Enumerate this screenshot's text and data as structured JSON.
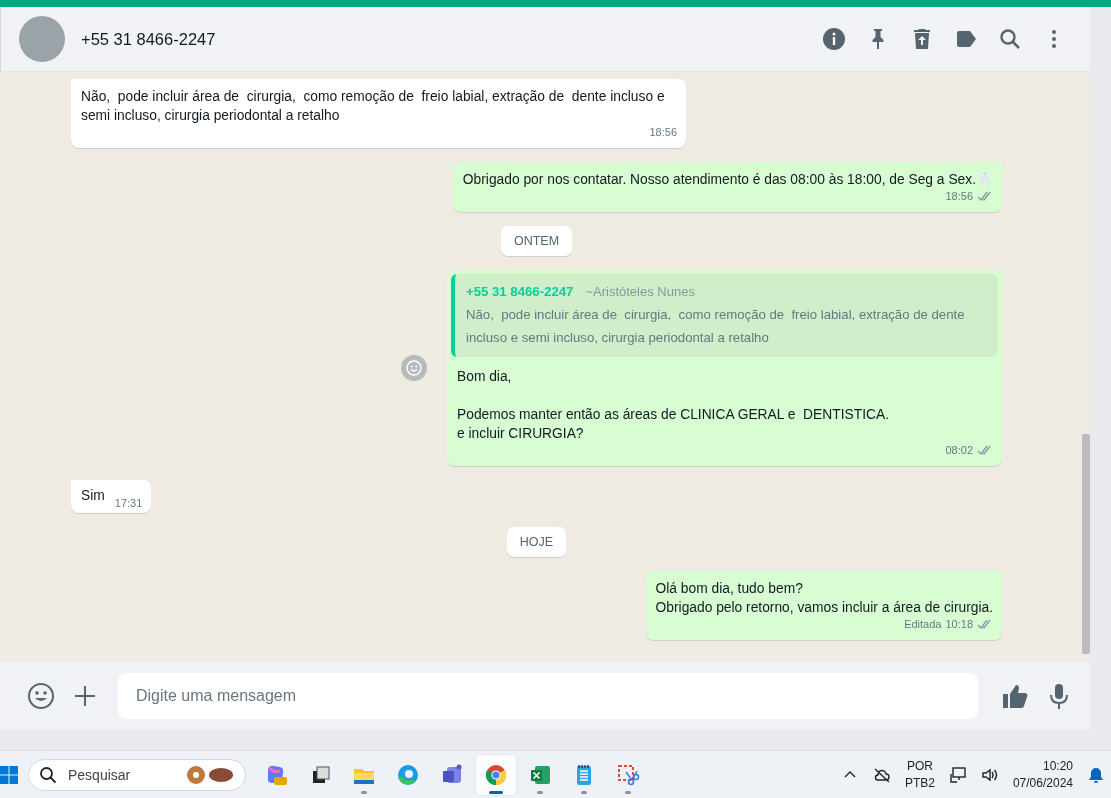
{
  "header": {
    "contact": "+55 31 8466-2247"
  },
  "messages": [
    {
      "kind": "partial"
    },
    {
      "kind": "in",
      "text": "Não,  pode incluir área de  cirurgia,  como remoção de  freio labial, extração de  dente incluso e semi incluso, cirurgia periodontal a retalho",
      "time": "18:56"
    },
    {
      "kind": "out",
      "text": "Obrigado por nos contatar. Nosso atendimento é das 08:00 às 18:00, de Seg a Sex.🦷",
      "time": "18:56",
      "read": false
    },
    {
      "kind": "date",
      "text": "ONTEM"
    },
    {
      "kind": "out",
      "quote": {
        "author": "+55 31 8466-2247",
        "name": "~Aristóteles Nunes",
        "text": "Não,  pode incluir área de  cirurgia,  como remoção de  freio labial, extração de dente incluso e semi incluso, cirurgia periodontal a retalho"
      },
      "paragraphs": [
        [
          "Bom dia,"
        ],
        [
          "Podemos manter então as áreas de CLINICA GERAL e  DENTISTICA.",
          "e incluir CIRURGIA?"
        ]
      ],
      "time": "08:02",
      "read": false,
      "react": true
    },
    {
      "kind": "in",
      "text": "Sim",
      "time": "17:31"
    },
    {
      "kind": "date",
      "text": "HOJE"
    },
    {
      "kind": "out",
      "paragraphs": [
        [
          "Olá bom dia, tudo bem?",
          "Obrigado pelo retorno, vamos incluir a área de cirurgia."
        ]
      ],
      "edited": "Editada",
      "time": "10:18",
      "read": false
    }
  ],
  "composer": {
    "placeholder": "Digite uma mensagem"
  },
  "taskbar": {
    "search": {
      "placeholder": "Pesquisar"
    },
    "apps": [
      {
        "kind": "copilot",
        "selected": false,
        "running": false
      },
      {
        "kind": "taskview",
        "selected": false,
        "running": false
      },
      {
        "kind": "folder",
        "selected": false,
        "running": true
      },
      {
        "kind": "edge",
        "selected": false,
        "running": false
      },
      {
        "kind": "teams",
        "selected": false,
        "running": false
      },
      {
        "kind": "chrome",
        "selected": true,
        "running": true
      },
      {
        "kind": "excel",
        "selected": false,
        "running": true
      },
      {
        "kind": "notepad",
        "selected": false,
        "running": true
      },
      {
        "kind": "snip",
        "selected": false,
        "running": true
      }
    ],
    "language": "POR",
    "layout": "PTB2",
    "time": "10:20",
    "date": "07/06/2024"
  }
}
